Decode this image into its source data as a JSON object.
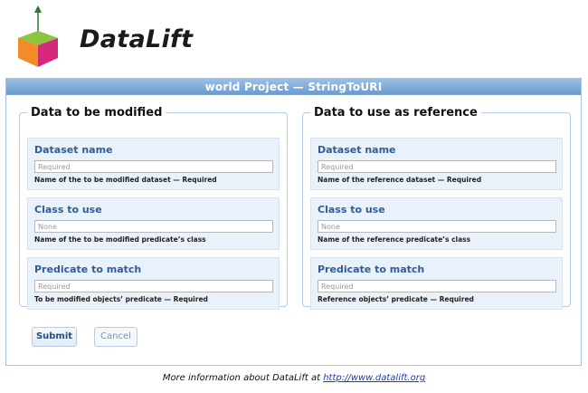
{
  "brand": {
    "name": "DataLift"
  },
  "panel": {
    "title": "world Project — StringToURI"
  },
  "left_column": {
    "legend": "Data to be modified",
    "fields": [
      {
        "label": "Dataset name",
        "placeholder": "Required",
        "hint": "Name of the to be modified dataset — Required"
      },
      {
        "label": "Class to use",
        "placeholder": "None",
        "hint": "Name of the to be modified predicate’s class"
      },
      {
        "label": "Predicate to match",
        "placeholder": "Required",
        "hint": "To be modified objects’ predicate — Required"
      }
    ]
  },
  "right_column": {
    "legend": "Data to use as reference",
    "fields": [
      {
        "label": "Dataset name",
        "placeholder": "Required",
        "hint": "Name of the reference dataset — Required"
      },
      {
        "label": "Class to use",
        "placeholder": "None",
        "hint": "Name of the reference predicate’s class"
      },
      {
        "label": "Predicate to match",
        "placeholder": "Required",
        "hint": "Reference objects’ predicate — Required"
      }
    ]
  },
  "buttons": {
    "submit": "Submit",
    "cancel": "Cancel"
  },
  "footer": {
    "text": "More information about DataLift at ",
    "link": "http://www.datalift.org"
  },
  "colors": {
    "header": "#7aa7d6",
    "field_bg": "#e9f1fa",
    "label": "#2e5e95",
    "link": "#1a3fb8"
  }
}
